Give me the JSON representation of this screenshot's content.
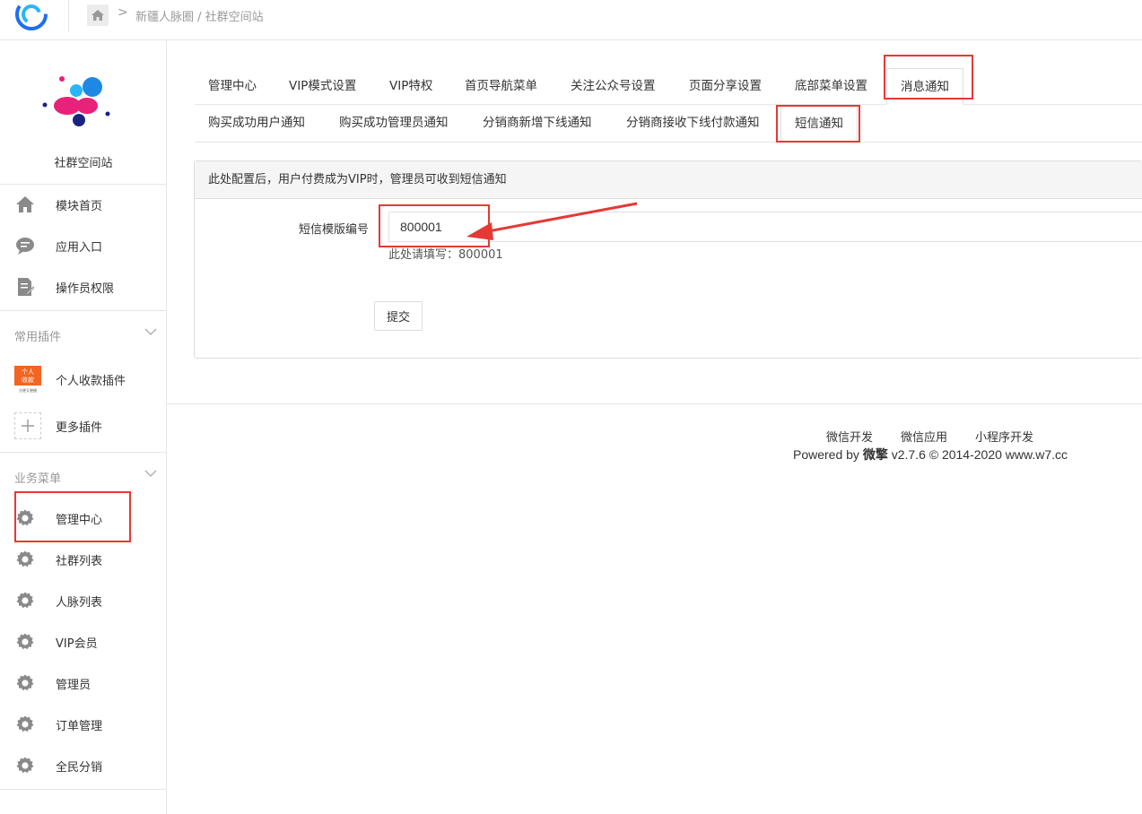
{
  "header": {
    "breadcrumb": "新疆人脉圈 / 社群空间站"
  },
  "sidebar": {
    "brand_name": "社群空间站",
    "top_items": [
      {
        "label": "模块首页",
        "icon": "home-icon"
      },
      {
        "label": "应用入口",
        "icon": "chat-icon"
      },
      {
        "label": "操作员权限",
        "icon": "edit-doc-icon"
      }
    ],
    "plugins_section": "常用插件",
    "plugin_items": [
      {
        "label": "个人收款插件",
        "icon": "personal-payment-icon",
        "icon_text_1": "个人",
        "icon_text_2": "收款",
        "icon_text_3": "方便又便捷"
      },
      {
        "label": "更多插件",
        "icon": "plus-icon"
      }
    ],
    "business_section": "业务菜单",
    "business_items": [
      {
        "label": "管理中心",
        "icon": "gear-icon"
      },
      {
        "label": "社群列表",
        "icon": "gear-icon"
      },
      {
        "label": "人脉列表",
        "icon": "gear-icon"
      },
      {
        "label": "VIP会员",
        "icon": "gear-icon"
      },
      {
        "label": "管理员",
        "icon": "gear-icon"
      },
      {
        "label": "订单管理",
        "icon": "gear-icon"
      },
      {
        "label": "全民分销",
        "icon": "gear-icon"
      }
    ]
  },
  "tabs": [
    {
      "label": "管理中心"
    },
    {
      "label": "VIP模式设置"
    },
    {
      "label": "VIP特权"
    },
    {
      "label": "首页导航菜单"
    },
    {
      "label": "关注公众号设置"
    },
    {
      "label": "页面分享设置"
    },
    {
      "label": "底部菜单设置"
    },
    {
      "label": "消息通知"
    }
  ],
  "subtabs": [
    {
      "label": "购买成功用户通知"
    },
    {
      "label": "购买成功管理员通知"
    },
    {
      "label": "分销商新增下线通知"
    },
    {
      "label": "分销商接收下线付款通知"
    },
    {
      "label": "短信通知"
    }
  ],
  "panel": {
    "heading": "此处配置后，用户付费成为VIP时，管理员可收到短信通知",
    "field_label": "短信模版编号",
    "field_value": "800001",
    "help_text": "此处请填写：800001",
    "submit_label": "提交"
  },
  "footer": {
    "links": [
      "微信开发",
      "微信应用",
      "小程序开发"
    ],
    "powered_prefix": "Powered by ",
    "powered_brand": "微擎",
    "powered_suffix": " v2.7.6 © 2014-2020 www.w7.cc"
  },
  "colors": {
    "highlight": "#e53935",
    "gear": "#8a8a8a",
    "brand_pink": "#e8217a",
    "brand_blue": "#1e88e5",
    "brand_navy": "#1a237e"
  }
}
